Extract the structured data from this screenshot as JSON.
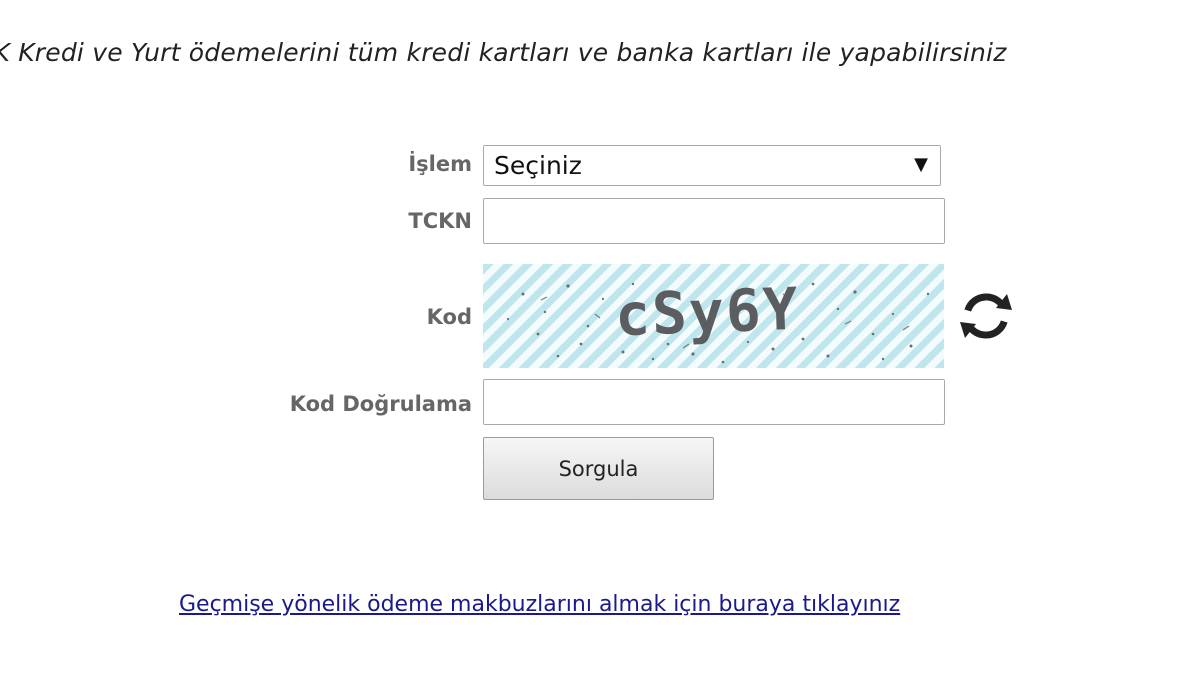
{
  "banner": {
    "text": "YK Kredi ve Yurt ödemelerini tüm kredi kartları ve banka kartları ile yapabilirsiniz"
  },
  "form": {
    "islem_label": "İşlem",
    "islem_selected": "Seçiniz",
    "tckn_label": "TCKN",
    "tckn_value": "",
    "kod_label": "Kod",
    "captcha_text": "cSy6Y",
    "kod_dogrulama_label": "Kod Doğrulama",
    "kod_dogrulama_value": "",
    "submit_label": "Sorgula"
  },
  "icons": {
    "select_arrow": "caret-down-icon",
    "refresh": "refresh-icon"
  },
  "footer": {
    "link_text": "Geçmişe yönelik ödeme makbuzlarını almak için buraya tıklayınız"
  },
  "colors": {
    "label": "#666666",
    "link": "#1a1a8c",
    "captcha_stripe": "#bfe6ec",
    "refresh_icon": "#222222"
  }
}
